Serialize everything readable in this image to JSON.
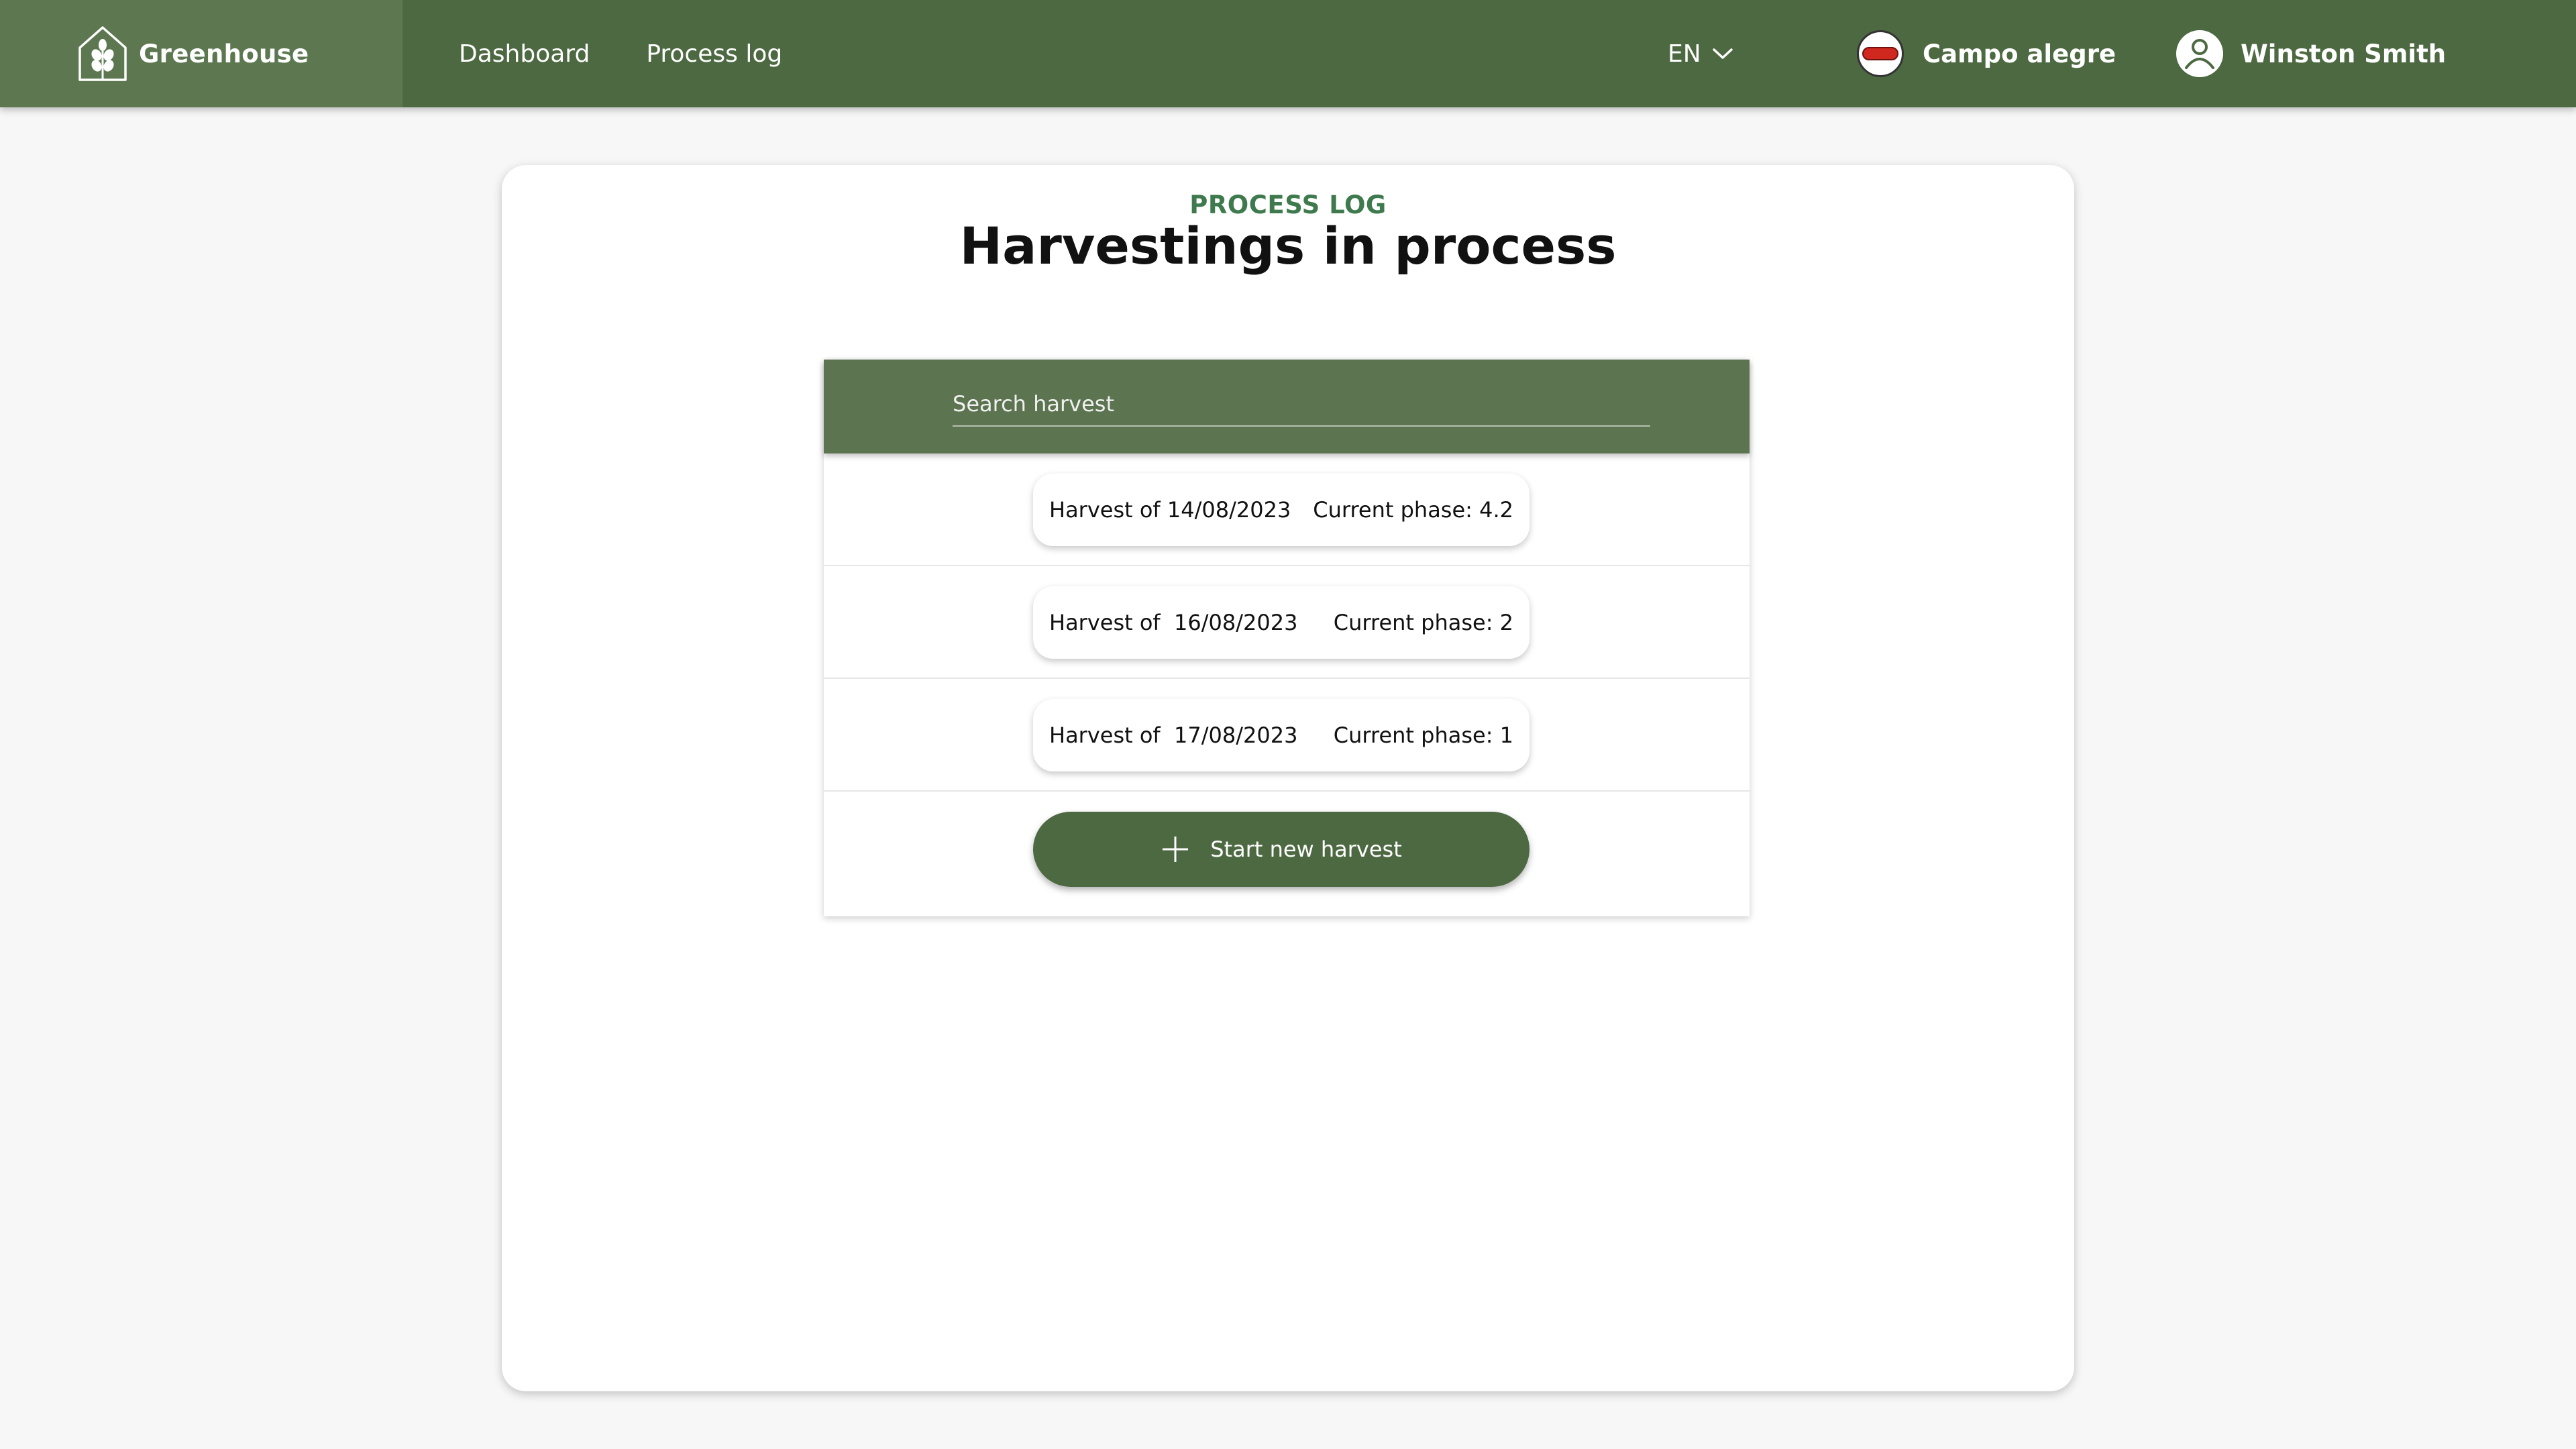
{
  "header": {
    "brand": "Greenhouse",
    "nav": [
      {
        "label": "Dashboard"
      },
      {
        "label": "Process log"
      }
    ],
    "language": "EN",
    "farm": "Campo alegre",
    "user": "Winston Smith"
  },
  "page": {
    "eyebrow": "PROCESS LOG",
    "title": "Harvestings in process"
  },
  "search": {
    "placeholder": "Search harvest"
  },
  "harvests": [
    {
      "name": "Harvest of 14/08/2023",
      "phase": "Current phase: 4.2"
    },
    {
      "name": "Harvest of  16/08/2023",
      "phase": "Current phase: 2"
    },
    {
      "name": "Harvest of  17/08/2023",
      "phase": "Current phase: 1"
    }
  ],
  "actions": {
    "start_new": "Start new harvest"
  },
  "colors": {
    "primary": "#4d6941",
    "brand_block": "#5d7851",
    "search_bar": "#5c7450",
    "accent_text": "#3e7a4d",
    "background": "#f7f7f7"
  }
}
